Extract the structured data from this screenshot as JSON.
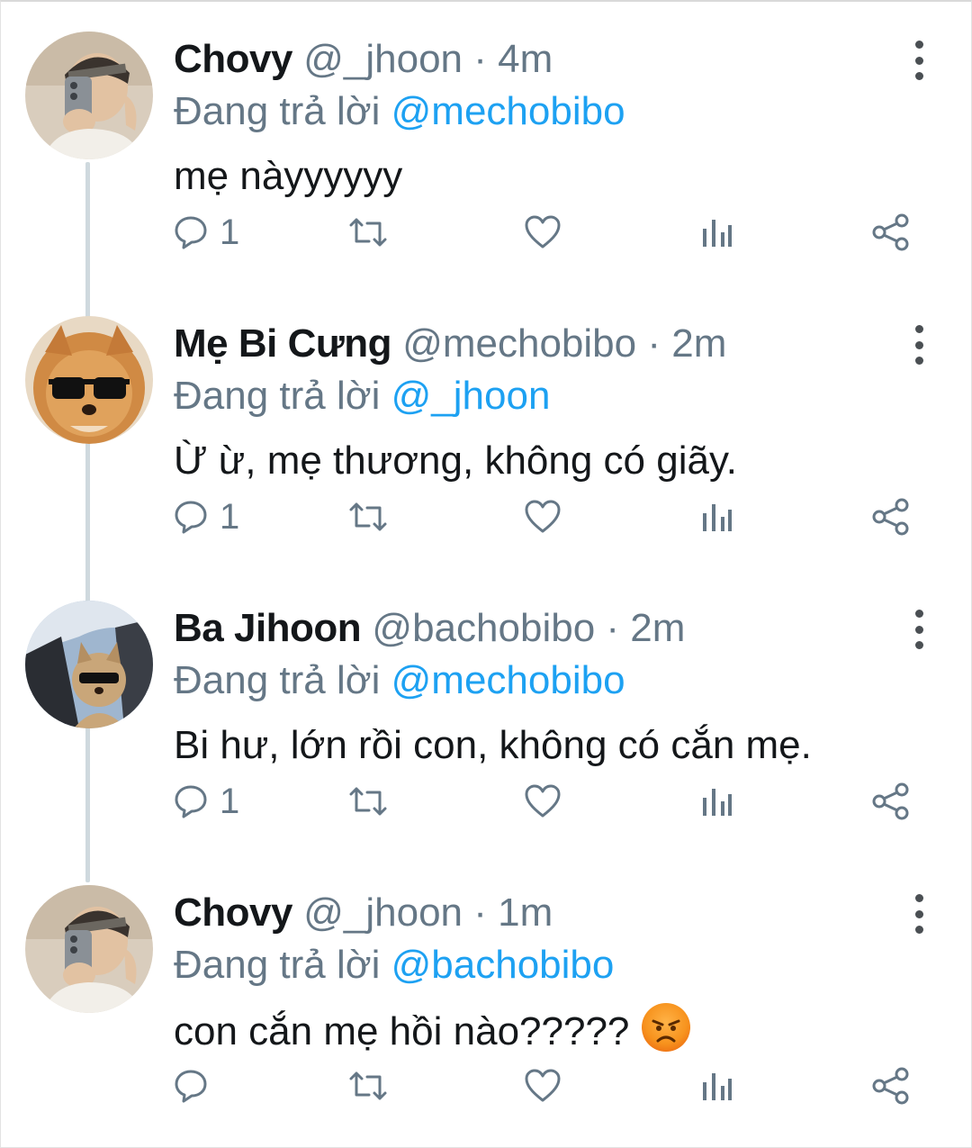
{
  "reply_prefix": "Đang trả lời",
  "tweets": [
    {
      "name": "Chovy",
      "handle": "@_jhoon",
      "separator": "·",
      "time": "4m",
      "reply_to": "@mechobibo",
      "text": "mẹ nàyyyyyy",
      "reply_count": "1",
      "avatar": "selfie-person-avatar"
    },
    {
      "name": "Mẹ Bi Cưng",
      "handle": "@mechobibo",
      "separator": "·",
      "time": "2m",
      "reply_to": "@_jhoon",
      "text": "Ừ ừ, mẹ thương, không có giãy.",
      "reply_count": "1",
      "avatar": "dog-sunglasses-avatar"
    },
    {
      "name": "Ba Jihoon",
      "handle": "@bachobibo",
      "separator": "·",
      "time": "2m",
      "reply_to": "@mechobibo",
      "text": "Bi hư, lớn rồi con, không có cắn mẹ.",
      "reply_count": "1",
      "avatar": "dog-in-car-avatar"
    },
    {
      "name": "Chovy",
      "handle": "@_jhoon",
      "separator": "·",
      "time": "1m",
      "reply_to": "@bachobibo",
      "text": "con cắn mẹ hồi nào?????",
      "text_emoji": "angry-face-emoji",
      "reply_count": "",
      "avatar": "selfie-person-avatar"
    }
  ],
  "colors": {
    "link": "#1da1f2",
    "secondary_text": "#657786",
    "primary_text": "#14171a",
    "thread_line": "#cfd9de"
  },
  "icons": [
    "reply-icon",
    "retweet-icon",
    "like-icon",
    "analytics-icon",
    "share-icon",
    "more-options-icon"
  ]
}
